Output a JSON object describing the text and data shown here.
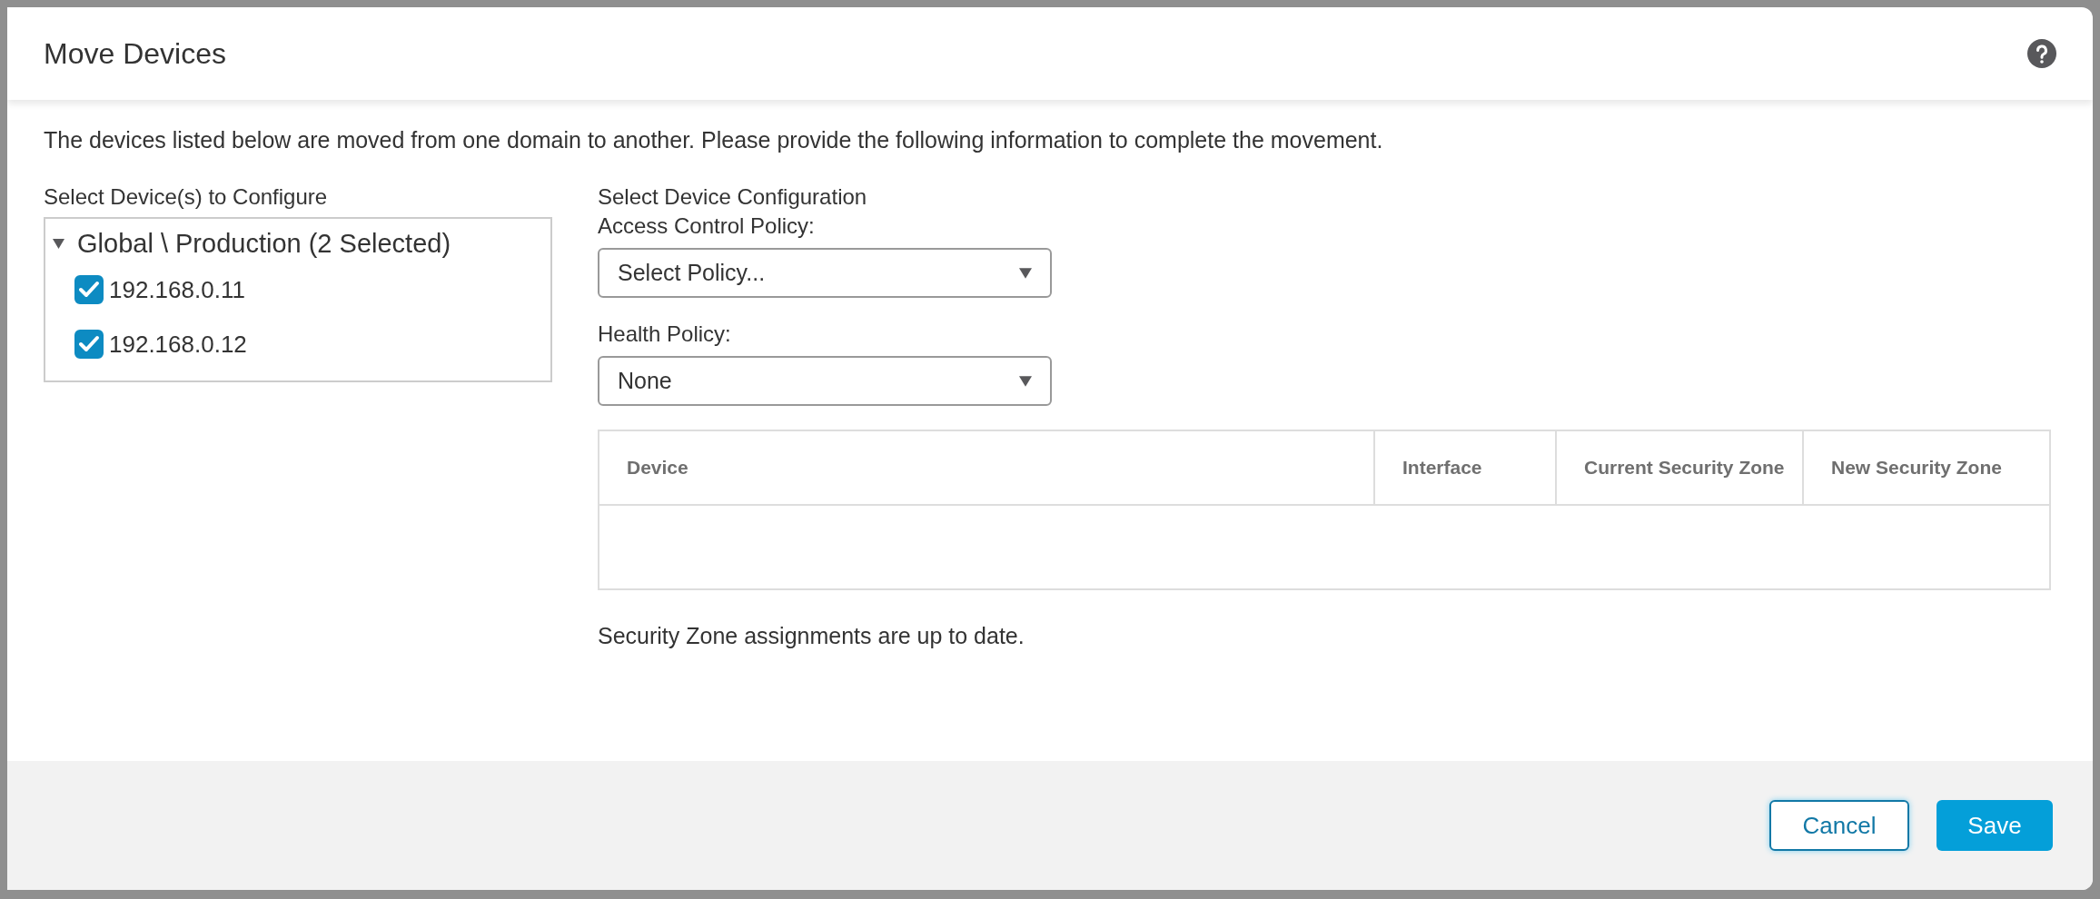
{
  "dialog": {
    "title": "Move Devices",
    "intro": "The devices listed below are moved from one domain to another. Please provide the following information to complete the movement."
  },
  "device_tree": {
    "label": "Select Device(s) to Configure",
    "root": {
      "label": "Global \\ Production (2 Selected)",
      "expanded": true,
      "children": [
        {
          "label": "192.168.0.11",
          "checked": true
        },
        {
          "label": "192.168.0.12",
          "checked": true
        }
      ]
    }
  },
  "configuration": {
    "heading": "Select Device Configuration",
    "fields": [
      {
        "label": "Access Control Policy:",
        "value": "Select Policy..."
      },
      {
        "label": "Health Policy:",
        "value": "None"
      }
    ]
  },
  "table": {
    "columns": [
      "Device",
      "Interface",
      "Current Security Zone",
      "New Security Zone"
    ]
  },
  "status": "Security Zone assignments are up to date.",
  "buttons": [
    {
      "label": "Cancel",
      "kind": "secondary"
    },
    {
      "label": "Save",
      "kind": "primary"
    }
  ]
}
